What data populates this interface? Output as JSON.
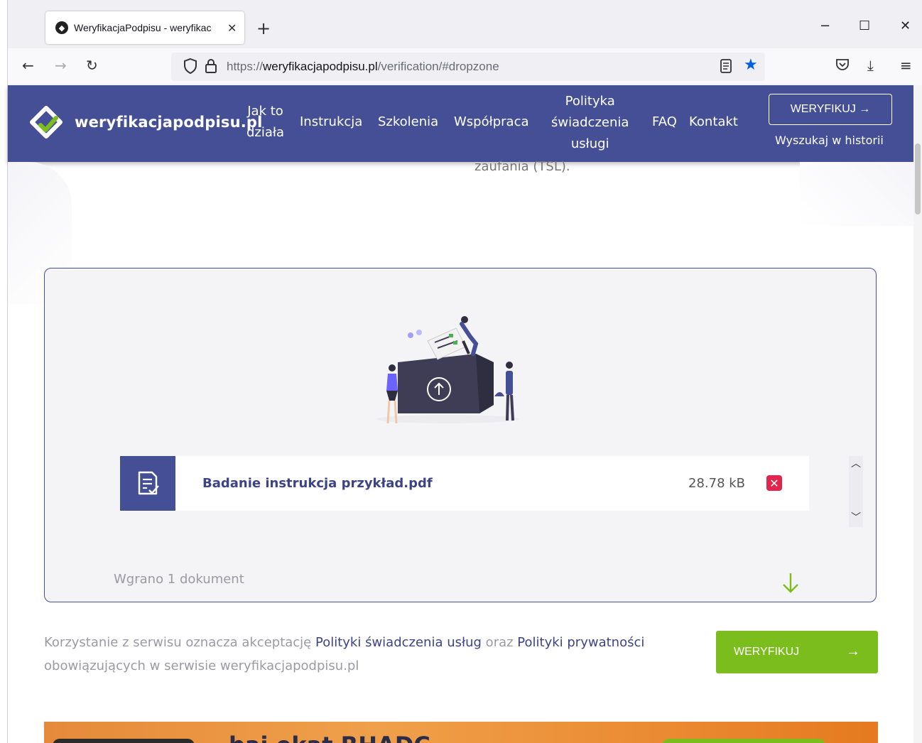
{
  "browser": {
    "tab_title": "WeryfikacjaPodpisu - weryfikac",
    "tab_close": "✕",
    "new_tab": "+",
    "win_min": "−",
    "win_max": "☐",
    "win_close": "✕",
    "url_prefix": "https://",
    "url_domain": "weryfikacjapodpisu.pl",
    "url_path": "/verification/#dropzone"
  },
  "header": {
    "logo": "weryfikacjapodpisu.pl",
    "menu": {
      "jak_to_dziala_1": "Jak to",
      "jak_to_dziala_2": "działa",
      "instrukcja": "Instrukcja",
      "szkolenia": "Szkolenia",
      "wspolpraca": "Współpraca",
      "polityka_1": "Polityka",
      "polityka_2": "świadczenia",
      "polityka_3": "usługi",
      "faq": "FAQ",
      "kontakt": "Kontakt"
    },
    "verify_button": "WERYFIKUJ →",
    "history_link": "Wyszukaj w historii"
  },
  "content": {
    "tsl_text": "zaufania (TSL).",
    "file": {
      "name": "Badanie instrukcja przykład.pdf",
      "size": "28.78 kB",
      "remove": "✕"
    },
    "uploaded_count": "Wgrano 1 dokument",
    "terms": {
      "t1": "Korzystanie z serwisu oznacza akceptację ",
      "l1": "Polityki świadczenia usług",
      "t2": " oraz ",
      "l2": "Polityki prywatności",
      "t3": " obowiązujących w serwisie weryfikacjapodpisu.pl"
    },
    "verify_button": "WERYFIKUJ",
    "verify_arrow": "→",
    "banner_text": "bai         ekat      RHADC"
  },
  "colors": {
    "brand": "#454f96",
    "accent_green": "#7cbd1e",
    "remove_red": "#e0254f"
  }
}
